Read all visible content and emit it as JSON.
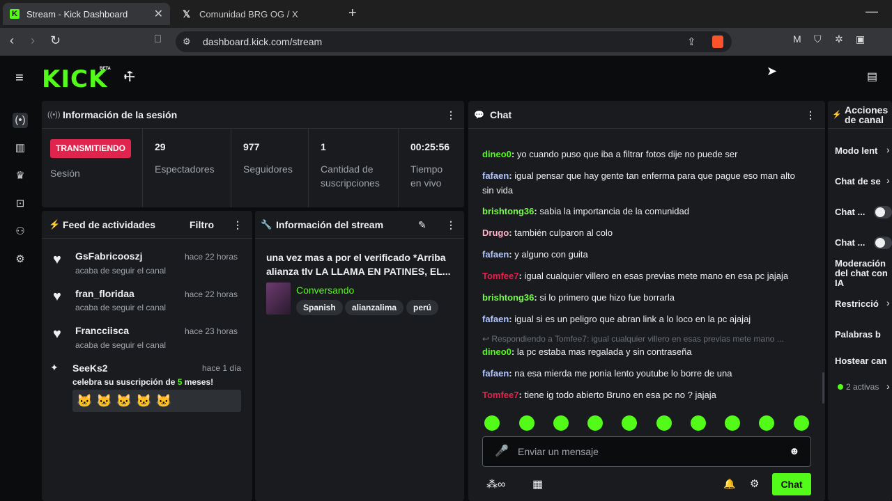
{
  "browser": {
    "tabs": [
      {
        "title": "Stream - Kick Dashboard",
        "active": true
      },
      {
        "title": "Comunidad BRG OG / X",
        "active": false
      }
    ],
    "url": "dashboard.kick.com/stream"
  },
  "brand": {
    "logo": "KICK",
    "badge": "BETA",
    "accent": "#53fc18"
  },
  "session": {
    "title": "Información de la sesión",
    "status": "TRANSMITIENDO",
    "status_label": "Sesión",
    "stats": [
      {
        "value": "29",
        "label": "Espectadores"
      },
      {
        "value": "977",
        "label": "Seguidores"
      },
      {
        "value": "1",
        "label": "Cantidad de suscripciones"
      },
      {
        "value": "00:25:56",
        "label": "Tiempo en vivo"
      }
    ]
  },
  "feed": {
    "title": "Feed de actividades",
    "filter": "Filtro",
    "items": [
      {
        "name": "GsFabricooszj",
        "time": "hace 22 horas",
        "text": "acaba de seguir el canal"
      },
      {
        "name": "fran_floridaa",
        "time": "hace 22 horas",
        "text": "acaba de seguir el canal"
      },
      {
        "name": "Francciisca",
        "time": "hace 23 horas",
        "text": "acaba de seguir el canal"
      }
    ],
    "sub": {
      "name": "SeeKs2",
      "time": "hace 1 día",
      "text_pre": "celebra su suscripción de ",
      "months": "5",
      "text_post": " meses!"
    }
  },
  "stream_info": {
    "title": "Información del stream",
    "stream_title": "una vez mas a por el verificado *Arriba alianza tlv LA LLAMA EN PATINES, EL...",
    "category": "Conversando",
    "tags": [
      "Spanish",
      "alianzalima",
      "perú"
    ]
  },
  "chat": {
    "title": "Chat",
    "messages": [
      {
        "user": "dineo0",
        "color": "#53fc18",
        "text": "yo cuando puso que iba a filtrar fotos dije no puede ser"
      },
      {
        "user": "fafaen",
        "color": "#b3c7ff",
        "text": "igual pensar que hay gente tan enferma para que pague eso man alto sin vida"
      },
      {
        "user": "brishtong36",
        "color": "#75fd46",
        "text": "sabia la importancia de la comunidad"
      },
      {
        "user": "Drugo",
        "color": "#ffb3c7",
        "text": "también culparon al colo"
      },
      {
        "user": "fafaen",
        "color": "#b3c7ff",
        "text": "y alguno con guita"
      },
      {
        "user": "Tomfee7",
        "color": "#e0244e",
        "text": "igual cualquier villero en esas previas mete mano en esa pc jajaja"
      },
      {
        "user": "brishtong36",
        "color": "#75fd46",
        "text": "si lo primero que hizo fue borrarla"
      },
      {
        "user": "fafaen",
        "color": "#b3c7ff",
        "text": "igual si es un peligro que abran link a lo loco en la pc ajajaj"
      },
      {
        "user": "dineo0",
        "color": "#53fc18",
        "text": "la pc estaba mas regalada y sin contraseña"
      },
      {
        "user": "fafaen",
        "color": "#b3c7ff",
        "text": "na esa mierda me ponia lento youtube lo borre de una"
      },
      {
        "user": "Tomfee7",
        "color": "#e0244e",
        "text": "tiene ig todo abierto Bruno en esa pc no ? jajaja"
      }
    ],
    "reply_hint": "Respondiendo a Tomfee7: igual cualquier villero en esas previas mete mano ...",
    "input_placeholder": "Enviar un mensaje",
    "send_label": "Chat"
  },
  "actions": {
    "title": "Acciones de canal",
    "items": [
      "Modo lent",
      "Chat de se",
      "Chat ...",
      "Chat ...",
      "Moderación del chat con IA",
      "Restricció",
      "Palabras b",
      "Hostear can"
    ],
    "active_count": "2 activas"
  }
}
